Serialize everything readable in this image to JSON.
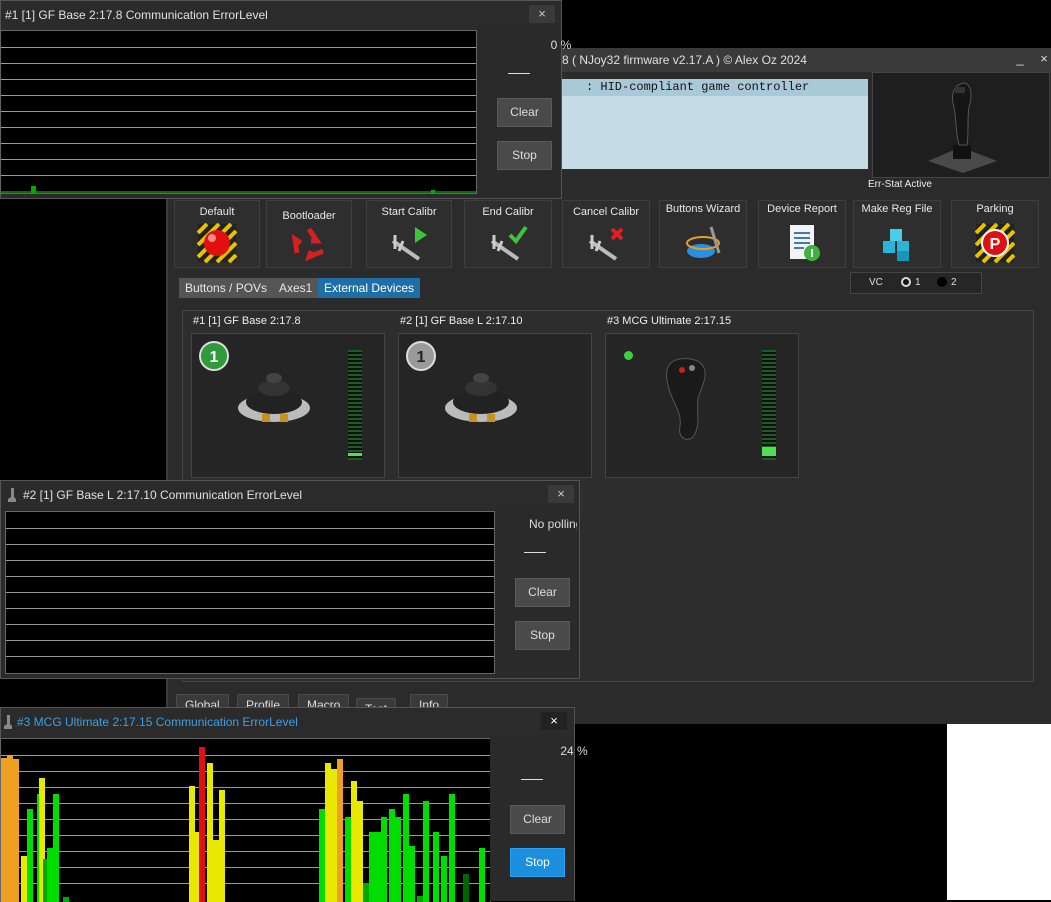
{
  "main": {
    "title": "8 ( NJoy32 firmware v2.17.A ) © Alex Oz 2024",
    "minimize": "_",
    "close": "×",
    "device_list_selected": ": HID-compliant game controller",
    "err_stat": "Err-Stat Active",
    "toolbar": [
      {
        "label": "Default",
        "icon": "red-ball-icon"
      },
      {
        "label": "Bootloader",
        "icon": "recycle-icon"
      },
      {
        "label": "Start Calibr",
        "icon": "caliper-play-icon"
      },
      {
        "label": "End Calibr",
        "icon": "caliper-check-icon"
      },
      {
        "label": "Cancel Calibr",
        "icon": "caliper-cancel-icon"
      },
      {
        "label": "Buttons Wizard",
        "icon": "wand-icon"
      },
      {
        "label": "Device Report",
        "icon": "report-icon"
      },
      {
        "label": "Make Reg File",
        "icon": "cubes-icon"
      },
      {
        "label": "Parking",
        "icon": "parking-icon"
      }
    ],
    "tabs": [
      {
        "label": "Buttons / POVs",
        "active": false
      },
      {
        "label": "Axes1",
        "active": false
      },
      {
        "label": "External Devices",
        "active": true
      }
    ],
    "vc": {
      "label": "VC",
      "opt1": "1",
      "opt2": "2"
    },
    "devices": [
      {
        "title": "#1 [1] GF Base 2:17.8",
        "badge": "1",
        "badge_color": "#2e9a3a",
        "level": 0.03
      },
      {
        "title": "#2 [1] GF Base L 2:17.10",
        "badge": "1",
        "badge_color": "#9a9a9a"
      },
      {
        "title": "#3 MCG Ultimate 2:17.15",
        "level": 0.08
      }
    ],
    "bottom_tabs": [
      "Global",
      "Profile",
      "Macro",
      "Test",
      "Info"
    ]
  },
  "monitors": [
    {
      "title": "#1 [1] GF Base  2:17.8  Communication ErrorLevel",
      "percent": "0 %",
      "clear": "Clear",
      "stop": "Stop",
      "close": "×"
    },
    {
      "title": "#2 [1] GF Base L  2:17.10  Communication ErrorLevel",
      "percent": "No polling",
      "clear": "Clear",
      "stop": "Stop",
      "close": "×"
    },
    {
      "title": "#3 MCG Ultimate  2:17.15  Communication ErrorLevel",
      "percent": "24 %",
      "clear": "Clear",
      "stop": "Stop",
      "close": "×",
      "bars": [
        [
          0.93,
          "#f0a020"
        ],
        [
          0.95,
          "#f0a020"
        ],
        [
          0.92,
          "#f0a020"
        ],
        [
          0.3,
          "#e8e800"
        ],
        [
          0.6,
          "#00dd00"
        ],
        [
          0.7,
          "#00dd00"
        ],
        [
          0.8,
          "#e8e800"
        ],
        [
          0.28,
          "#00aa00"
        ],
        [
          0.35,
          "#00dd00"
        ],
        [
          0.7,
          "#00dd00"
        ],
        [
          0.03,
          "#00aa00"
        ],
        [
          0.75,
          "#e8e800"
        ],
        [
          0.45,
          "#e8e800"
        ],
        [
          1.0,
          "#e01010"
        ],
        [
          0.9,
          "#e8e800"
        ],
        [
          0.4,
          "#e8e800"
        ],
        [
          0.72,
          "#e8e800"
        ],
        [
          0.6,
          "#00dd00"
        ],
        [
          0.9,
          "#e8e800"
        ],
        [
          0.86,
          "#e8e800"
        ],
        [
          0.92,
          "#f0a020"
        ],
        [
          0.55,
          "#00dd00"
        ],
        [
          0.78,
          "#e8e800"
        ],
        [
          0.65,
          "#e8e800"
        ],
        [
          0.12,
          "#00aa00"
        ],
        [
          0.45,
          "#00dd00"
        ],
        [
          0.45,
          "#00dd00"
        ],
        [
          0.55,
          "#00dd00"
        ],
        [
          0.6,
          "#00dd00"
        ],
        [
          0.55,
          "#00dd00"
        ],
        [
          0.7,
          "#00dd00"
        ],
        [
          0.36,
          "#00dd00"
        ],
        [
          0.04,
          "#00aa00"
        ],
        [
          0.65,
          "#00dd00"
        ],
        [
          0.45,
          "#00dd00"
        ],
        [
          0.3,
          "#00dd00"
        ],
        [
          0.7,
          "#00dd00"
        ],
        [
          0.18,
          "#006600"
        ],
        [
          0.35,
          "#00dd00"
        ]
      ]
    }
  ]
}
